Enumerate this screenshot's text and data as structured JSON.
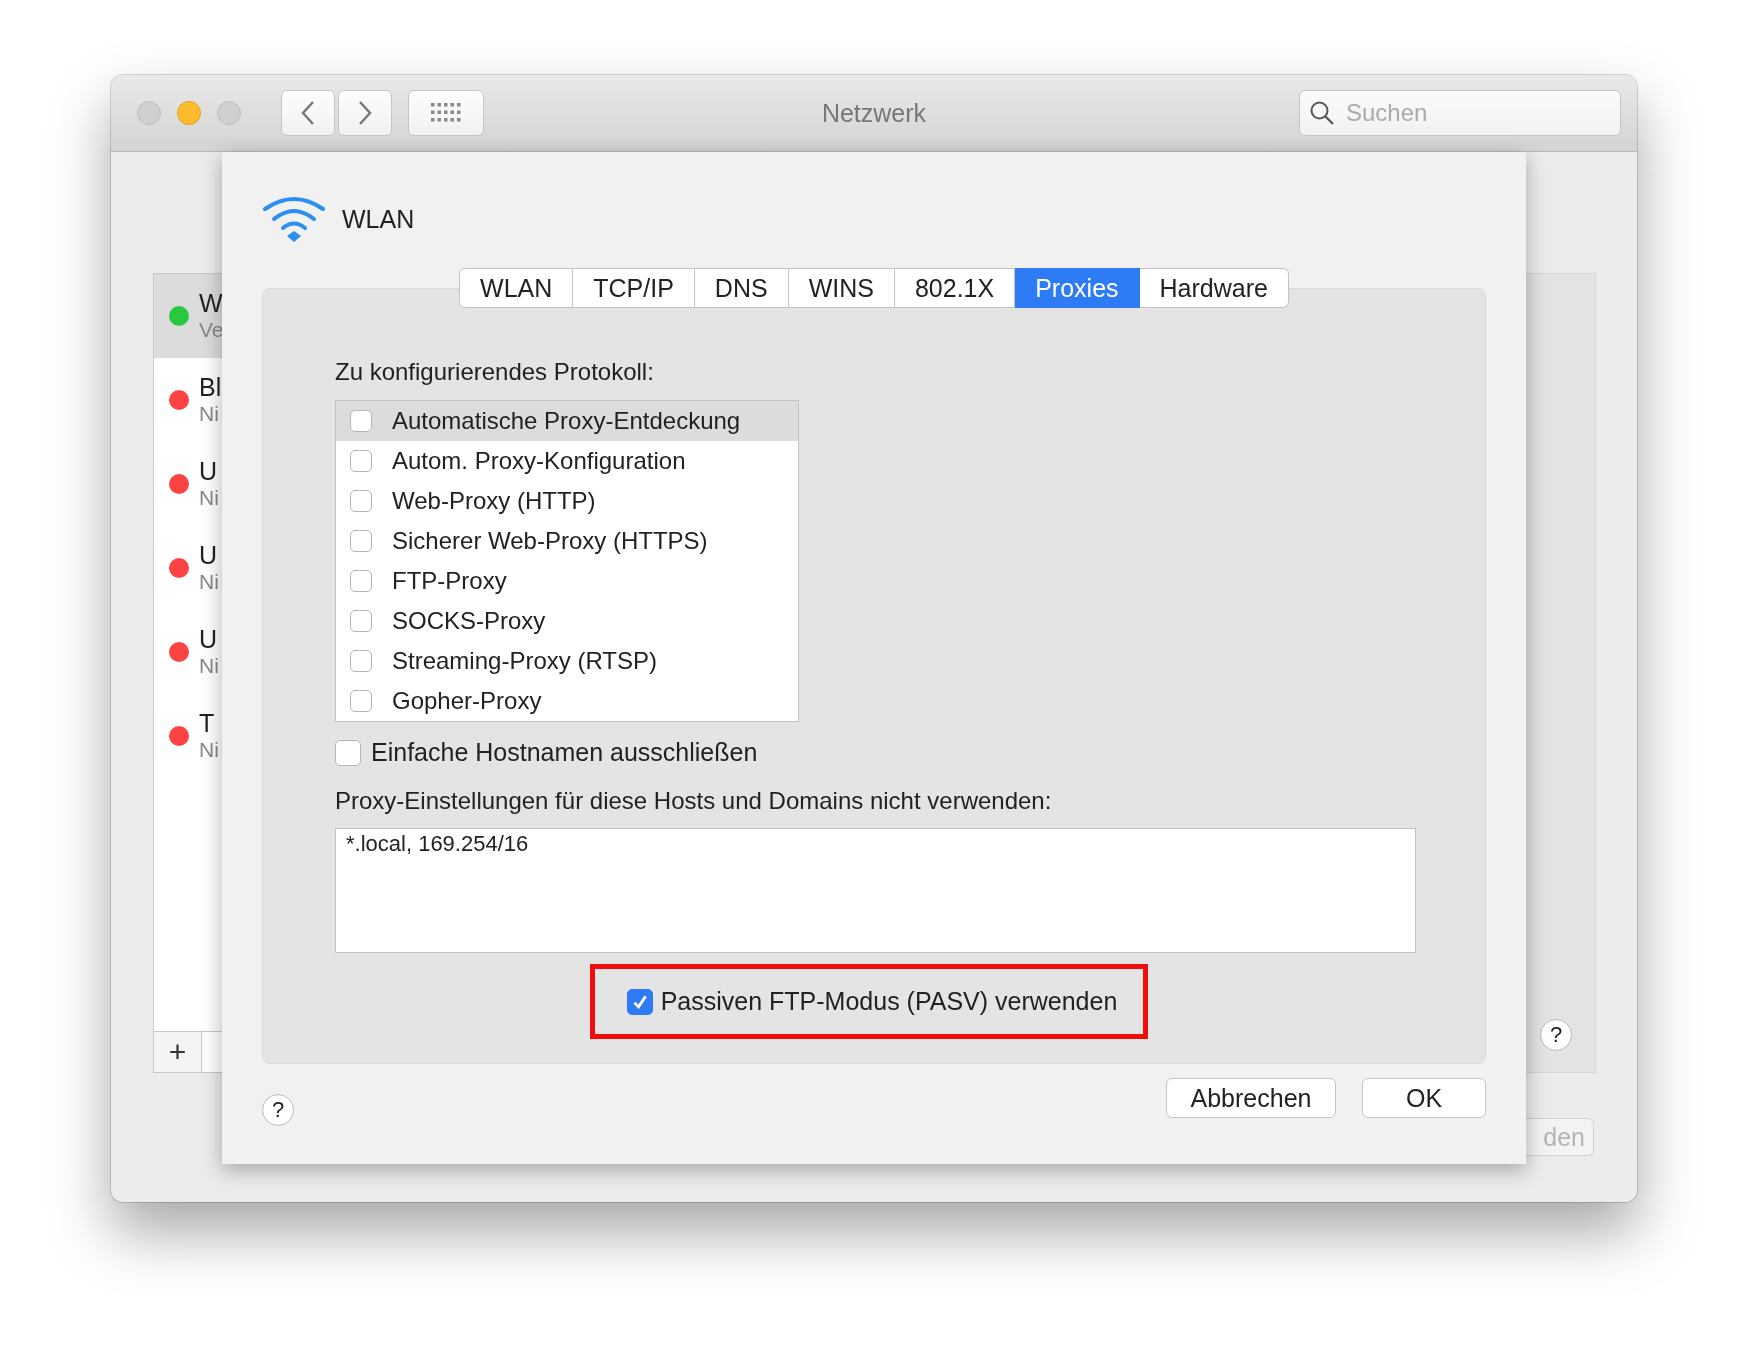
{
  "window": {
    "title": "Netzwerk",
    "search": {
      "placeholder": "Suchen"
    }
  },
  "sidebar": {
    "items": [
      {
        "name": "W",
        "status": "Ve",
        "selected": true,
        "color": "#2ac840"
      },
      {
        "name": "Bl",
        "status": "Ni",
        "selected": false,
        "color": "#fb4343"
      },
      {
        "name": "U",
        "status": "Ni",
        "selected": false,
        "color": "#fb4343"
      },
      {
        "name": "U",
        "status": "Ni",
        "selected": false,
        "color": "#fb4343"
      },
      {
        "name": "U",
        "status": "Ni",
        "selected": false,
        "color": "#fb4343"
      },
      {
        "name": "T",
        "status": "Ni",
        "selected": false,
        "color": "#fb4343"
      }
    ],
    "add_button": "+"
  },
  "right_panel": {
    "help_button": "?",
    "button": "den"
  },
  "sheet": {
    "title": "WLAN",
    "tabs": [
      {
        "label": "WLAN",
        "selected": false
      },
      {
        "label": "TCP/IP",
        "selected": false
      },
      {
        "label": "DNS",
        "selected": false
      },
      {
        "label": "WINS",
        "selected": false
      },
      {
        "label": "802.1X",
        "selected": false
      },
      {
        "label": "Proxies",
        "selected": true
      },
      {
        "label": "Hardware",
        "selected": false
      }
    ],
    "protocol_label": "Zu konfigurierendes Protokoll:",
    "protocols": [
      {
        "label": "Automatische Proxy-Entdeckung",
        "checked": false,
        "selected": true
      },
      {
        "label": "Autom. Proxy-Konfiguration",
        "checked": false,
        "selected": false
      },
      {
        "label": "Web-Proxy (HTTP)",
        "checked": false,
        "selected": false
      },
      {
        "label": "Sicherer Web-Proxy (HTTPS)",
        "checked": false,
        "selected": false
      },
      {
        "label": "FTP-Proxy",
        "checked": false,
        "selected": false
      },
      {
        "label": "SOCKS-Proxy",
        "checked": false,
        "selected": false
      },
      {
        "label": "Streaming-Proxy (RTSP)",
        "checked": false,
        "selected": false
      },
      {
        "label": "Gopher-Proxy",
        "checked": false,
        "selected": false
      }
    ],
    "exclude_simple_hostnames": {
      "label": "Einfache Hostnamen ausschließen",
      "checked": false
    },
    "bypass_label": "Proxy-Einstellungen für diese Hosts und Domains nicht verwenden:",
    "bypass_value": "*.local, 169.254/16",
    "passive_ftp": {
      "label": "Passiven FTP-Modus (PASV) verwenden",
      "checked": true,
      "highlighted": true
    },
    "help_button": "?",
    "buttons": [
      {
        "label": "Abbrechen"
      },
      {
        "label": "OK"
      }
    ]
  }
}
